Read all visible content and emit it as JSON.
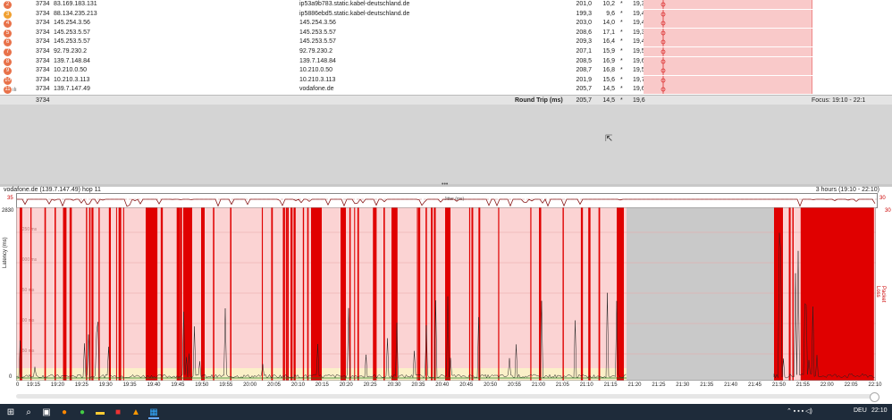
{
  "hops": [
    {
      "n": "2",
      "asn": "3734",
      "ip": "83.169.183.131",
      "name": "ip53a9b783.static.kabel-deutschland.de",
      "avg": "201,0",
      "min": "10,2",
      "cur": "*",
      "pl": "19,3",
      "c": "#e8724a"
    },
    {
      "n": "3",
      "asn": "3734",
      "ip": "88.134.235.213",
      "name": "ip5886ebd5.static.kabel-deutschland.de",
      "avg": "199,3",
      "min": "9,6",
      "cur": "*",
      "pl": "19,4",
      "c": "#f0a030"
    },
    {
      "n": "4",
      "asn": "3734",
      "ip": "145.254.3.56",
      "name": "145.254.3.56",
      "avg": "203,0",
      "min": "14,0",
      "cur": "*",
      "pl": "19,4",
      "c": "#e8724a"
    },
    {
      "n": "5",
      "asn": "3734",
      "ip": "145.253.5.57",
      "name": "145.253.5.57",
      "avg": "208,6",
      "min": "17,1",
      "cur": "*",
      "pl": "19,3",
      "c": "#e8724a"
    },
    {
      "n": "6",
      "asn": "3734",
      "ip": "145.253.5.57",
      "name": "145.253.5.57",
      "avg": "209,3",
      "min": "16,4",
      "cur": "*",
      "pl": "19,4",
      "c": "#e8724a"
    },
    {
      "n": "7",
      "asn": "3734",
      "ip": "92.79.230.2",
      "name": "92.79.230.2",
      "avg": "207,1",
      "min": "15,9",
      "cur": "*",
      "pl": "19,5",
      "c": "#e8724a"
    },
    {
      "n": "8",
      "asn": "3734",
      "ip": "139.7.148.84",
      "name": "139.7.148.84",
      "avg": "208,5",
      "min": "16,9",
      "cur": "*",
      "pl": "19,6",
      "c": "#e8724a"
    },
    {
      "n": "9",
      "asn": "3734",
      "ip": "10.210.0.50",
      "name": "10.210.0.50",
      "avg": "208,7",
      "min": "16,8",
      "cur": "*",
      "pl": "19,5",
      "c": "#e8724a"
    },
    {
      "n": "10",
      "asn": "3734",
      "ip": "10.210.3.113",
      "name": "10.210.3.113",
      "avg": "201,9",
      "min": "15,6",
      "cur": "*",
      "pl": "19,7",
      "c": "#e8724a"
    },
    {
      "n": "11",
      "asn": "3734",
      "ip": "139.7.147.49",
      "name": "vodafone.de",
      "avg": "205,7",
      "min": "14,5",
      "cur": "*",
      "pl": "19,6",
      "c": "#e8724a"
    }
  ],
  "footer": {
    "asn": "3734",
    "label": "Round Trip (ms)",
    "avg": "205,7",
    "min": "14,5",
    "cur": "*",
    "pl": "19,6",
    "focus": "Focus: 19:10 - 22:1"
  },
  "graph": {
    "title": "vodafone.de (139.7.147.49) hop 11",
    "range": "3 hours (19:10 - 22:10)",
    "strip_left": "35",
    "strip_right": "30",
    "strip_label": "Jitter (ms)",
    "y_top": "2830",
    "y_bottom": "0",
    "y_label": "Latency (ms)",
    "y2_label": "Packet Loss %",
    "y_right_top": "30",
    "grid_labels": [
      "1250 ms",
      "1000 ms",
      "750 ms",
      "500 ms",
      "250 ms"
    ],
    "xticks": [
      "0",
      "19:15",
      "19:20",
      "19:25",
      "19:30",
      "19:35",
      "19:40",
      "19:45",
      "19:50",
      "19:55",
      "20:00",
      "20:05",
      "20:10",
      "20:15",
      "20:20",
      "20:25",
      "20:30",
      "20:35",
      "20:40",
      "20:45",
      "20:50",
      "20:55",
      "21:00",
      "21:05",
      "21:10",
      "21:15",
      "21:20",
      "21:25",
      "21:30",
      "21:35",
      "21:40",
      "21:45",
      "21:50",
      "21:55",
      "22:00",
      "22:05",
      "22:10"
    ]
  },
  "chart_data": {
    "type": "area",
    "title": "vodafone.de (139.7.147.49) hop 11",
    "ylabel": "Latency (ms)",
    "ylim": [
      0,
      2830
    ],
    "series": [
      {
        "name": "Packet Loss %",
        "values": []
      }
    ],
    "gray_gap": [
      "21:15",
      "21:50"
    ]
  },
  "taskbar": {
    "lang": "DEU",
    "time": "22:10"
  }
}
